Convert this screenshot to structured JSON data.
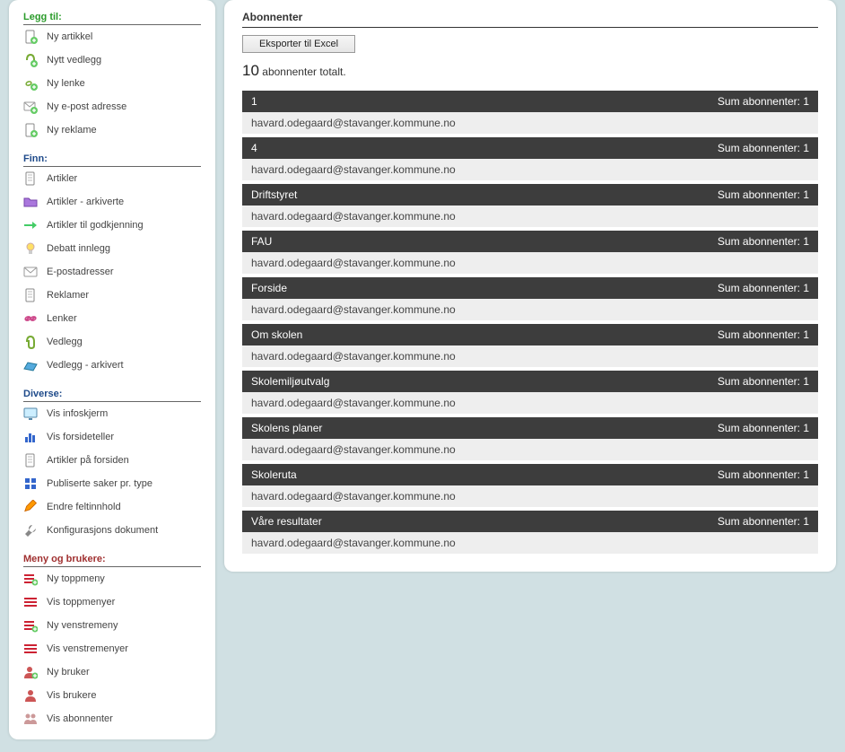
{
  "sidebar": {
    "sections": [
      {
        "title": "Legg til:",
        "color": "green",
        "items": [
          {
            "label": "Ny artikkel",
            "icon": "doc-plus"
          },
          {
            "label": "Nytt vedlegg",
            "icon": "attach-plus"
          },
          {
            "label": "Ny lenke",
            "icon": "link-plus"
          },
          {
            "label": "Ny e-post adresse",
            "icon": "mail-plus"
          },
          {
            "label": "Ny reklame",
            "icon": "doc-plus"
          }
        ]
      },
      {
        "title": "Finn:",
        "color": "blue",
        "items": [
          {
            "label": "Artikler",
            "icon": "doc"
          },
          {
            "label": "Artikler - arkiverte",
            "icon": "folder"
          },
          {
            "label": "Artikler til godkjenning",
            "icon": "approve"
          },
          {
            "label": "Debatt innlegg",
            "icon": "bulb"
          },
          {
            "label": "E-postadresser",
            "icon": "mail"
          },
          {
            "label": "Reklamer",
            "icon": "doc"
          },
          {
            "label": "Lenker",
            "icon": "link"
          },
          {
            "label": "Vedlegg",
            "icon": "attach"
          },
          {
            "label": "Vedlegg - arkivert",
            "icon": "archive"
          }
        ]
      },
      {
        "title": "Diverse:",
        "color": "blue",
        "items": [
          {
            "label": "Vis infoskjerm",
            "icon": "screen"
          },
          {
            "label": "Vis forsideteller",
            "icon": "bars"
          },
          {
            "label": "Artikler på forsiden",
            "icon": "doc"
          },
          {
            "label": "Publiserte saker pr. type",
            "icon": "grid"
          },
          {
            "label": "Endre feltinnhold",
            "icon": "pencil"
          },
          {
            "label": "Konfigurasjons dokument",
            "icon": "wrench"
          }
        ]
      },
      {
        "title": "Meny og brukere:",
        "color": "red",
        "items": [
          {
            "label": "Ny toppmeny",
            "icon": "menu-plus"
          },
          {
            "label": "Vis toppmenyer",
            "icon": "menu"
          },
          {
            "label": "Ny venstremeny",
            "icon": "menu-plus"
          },
          {
            "label": "Vis venstremenyer",
            "icon": "menu"
          },
          {
            "label": "Ny bruker",
            "icon": "user-plus"
          },
          {
            "label": "Vis brukere",
            "icon": "user"
          },
          {
            "label": "Vis abonnenter",
            "icon": "users"
          }
        ]
      }
    ]
  },
  "main": {
    "title": "Abonnenter",
    "export_label": "Eksporter til Excel",
    "total_count": "10",
    "total_suffix": "abonnenter totalt.",
    "sum_prefix": "Sum abonnenter:",
    "groups": [
      {
        "name": "1",
        "sum": "1",
        "emails": [
          "havard.odegaard@stavanger.kommune.no"
        ]
      },
      {
        "name": "4",
        "sum": "1",
        "emails": [
          "havard.odegaard@stavanger.kommune.no"
        ]
      },
      {
        "name": "Driftstyret",
        "sum": "1",
        "emails": [
          "havard.odegaard@stavanger.kommune.no"
        ]
      },
      {
        "name": "FAU",
        "sum": "1",
        "emails": [
          "havard.odegaard@stavanger.kommune.no"
        ]
      },
      {
        "name": "Forside",
        "sum": "1",
        "emails": [
          "havard.odegaard@stavanger.kommune.no"
        ]
      },
      {
        "name": "Om skolen",
        "sum": "1",
        "emails": [
          "havard.odegaard@stavanger.kommune.no"
        ]
      },
      {
        "name": "Skolemiljøutvalg",
        "sum": "1",
        "emails": [
          "havard.odegaard@stavanger.kommune.no"
        ]
      },
      {
        "name": "Skolens planer",
        "sum": "1",
        "emails": [
          "havard.odegaard@stavanger.kommune.no"
        ]
      },
      {
        "name": "Skoleruta",
        "sum": "1",
        "emails": [
          "havard.odegaard@stavanger.kommune.no"
        ]
      },
      {
        "name": "Våre resultater",
        "sum": "1",
        "emails": [
          "havard.odegaard@stavanger.kommune.no"
        ]
      }
    ]
  }
}
